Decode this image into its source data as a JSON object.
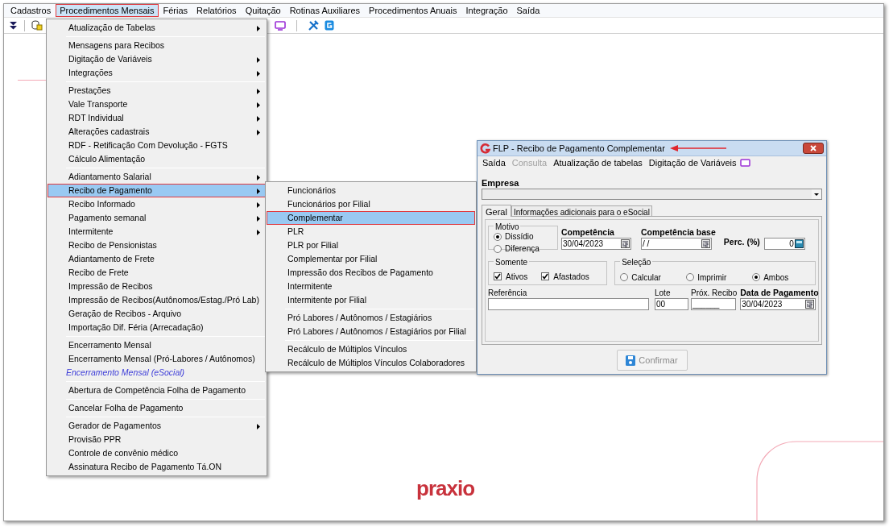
{
  "menubar": [
    {
      "label": "Cadastros",
      "selected": false
    },
    {
      "label": "Procedimentos Mensais",
      "selected": true
    },
    {
      "label": "Férias",
      "selected": false
    },
    {
      "label": "Relatórios",
      "selected": false
    },
    {
      "label": "Quitação",
      "selected": false
    },
    {
      "label": "Rotinas Auxiliares",
      "selected": false
    },
    {
      "label": "Procedimentos Anuais",
      "selected": false
    },
    {
      "label": "Integração",
      "selected": false
    },
    {
      "label": "Saída",
      "selected": false
    }
  ],
  "main_menu": {
    "groups": [
      [
        {
          "label": "Atualização de Tabelas",
          "submenu": true,
          "selected": false,
          "kind": "plain"
        }
      ],
      [
        {
          "label": "Mensagens para Recibos",
          "submenu": false,
          "selected": false,
          "kind": "plain"
        },
        {
          "label": "Digitação de Variáveis",
          "submenu": true,
          "selected": false,
          "kind": "plain"
        },
        {
          "label": "Integrações",
          "submenu": true,
          "selected": false,
          "kind": "plain"
        }
      ],
      [
        {
          "label": "Prestações",
          "submenu": true,
          "selected": false,
          "kind": "plain"
        },
        {
          "label": "Vale Transporte",
          "submenu": true,
          "selected": false,
          "kind": "plain"
        },
        {
          "label": "RDT Individual",
          "submenu": true,
          "selected": false,
          "kind": "plain"
        },
        {
          "label": "Alterações cadastrais",
          "submenu": true,
          "selected": false,
          "kind": "plain"
        },
        {
          "label": "RDF - Retificação Com Devolução - FGTS",
          "submenu": false,
          "selected": false,
          "kind": "plain"
        },
        {
          "label": "Cálculo Alimentação",
          "submenu": false,
          "selected": false,
          "kind": "plain"
        }
      ],
      [
        {
          "label": "Adiantamento Salarial",
          "submenu": true,
          "selected": false,
          "kind": "plain"
        },
        {
          "label": "Recibo de Pagamento",
          "submenu": true,
          "selected": true,
          "kind": "plain"
        },
        {
          "label": "Recibo Informado",
          "submenu": true,
          "selected": false,
          "kind": "plain"
        },
        {
          "label": "Pagamento semanal",
          "submenu": true,
          "selected": false,
          "kind": "plain"
        },
        {
          "label": "Intermitente",
          "submenu": true,
          "selected": false,
          "kind": "plain"
        },
        {
          "label": "Recibo de Pensionistas",
          "submenu": false,
          "selected": false,
          "kind": "plain"
        },
        {
          "label": "Adiantamento de Frete",
          "submenu": false,
          "selected": false,
          "kind": "plain"
        },
        {
          "label": "Recibo de Frete",
          "submenu": false,
          "selected": false,
          "kind": "plain"
        },
        {
          "label": "Impressão de Recibos",
          "submenu": false,
          "selected": false,
          "kind": "plain"
        },
        {
          "label": "Impressão de Recibos(Autônomos/Estag./Pró Lab)",
          "submenu": false,
          "selected": false,
          "kind": "plain"
        },
        {
          "label": "Geração de Recibos - Arquivo",
          "submenu": false,
          "selected": false,
          "kind": "plain"
        },
        {
          "label": "Importação Dif. Féria (Arrecadação)",
          "submenu": false,
          "selected": false,
          "kind": "plain"
        }
      ],
      [
        {
          "label": "Encerramento Mensal",
          "submenu": false,
          "selected": false,
          "kind": "plain"
        },
        {
          "label": "Encerramento Mensal (Pró-Labores / Autônomos)",
          "submenu": false,
          "selected": false,
          "kind": "plain"
        },
        {
          "label": "Encerramento Mensal (eSocial)",
          "submenu": false,
          "selected": false,
          "kind": "emphasized"
        }
      ],
      [
        {
          "label": "Abertura de Competência Folha de Pagamento",
          "submenu": false,
          "selected": false,
          "kind": "plain"
        }
      ],
      [
        {
          "label": "Cancelar Folha de Pagamento",
          "submenu": false,
          "selected": false,
          "kind": "plain"
        }
      ],
      [
        {
          "label": "Gerador de Pagamentos",
          "submenu": true,
          "selected": false,
          "kind": "plain"
        },
        {
          "label": "Provisão PPR",
          "submenu": false,
          "selected": false,
          "kind": "plain"
        },
        {
          "label": "Controle de convênio médico",
          "submenu": false,
          "selected": false,
          "kind": "plain"
        },
        {
          "label": "Assinatura Recibo de Pagamento Tá.ON",
          "submenu": false,
          "selected": false,
          "kind": "plain"
        }
      ]
    ]
  },
  "submenu": {
    "groups": [
      [
        {
          "label": "Funcionários",
          "selected": false
        },
        {
          "label": "Funcionários por Filial",
          "selected": false
        },
        {
          "label": "Complementar",
          "selected": true
        },
        {
          "label": "PLR",
          "selected": false
        },
        {
          "label": "PLR por Filial",
          "selected": false
        },
        {
          "label": "Complementar por Filial",
          "selected": false
        },
        {
          "label": "Impressão dos Recibos de Pagamento",
          "selected": false
        },
        {
          "label": "Intermitente",
          "selected": false
        },
        {
          "label": "Intermitente por Filial",
          "selected": false
        }
      ],
      [
        {
          "label": "Pró Labores / Autônomos / Estagiários",
          "selected": false
        },
        {
          "label": "Pró Labores / Autônomos / Estagiários por Filial",
          "selected": false
        }
      ],
      [
        {
          "label": "Recálculo de Múltiplos Vínculos",
          "selected": false
        },
        {
          "label": "Recálculo de Múltiplos Vínculos Colaboradores",
          "selected": false
        }
      ]
    ]
  },
  "dialog": {
    "title": "FLP - Recibo de Pagamento Complementar",
    "menu": [
      {
        "label": "Saída",
        "disabled": false
      },
      {
        "label": "Consulta",
        "disabled": true
      },
      {
        "label": "Atualização de tabelas",
        "disabled": false
      },
      {
        "label": "Digitação de Variáveis",
        "disabled": false
      }
    ],
    "empresa": {
      "label": "Empresa"
    },
    "tabs": [
      {
        "label": "Geral",
        "selected": true
      },
      {
        "label": "Informações adicionais para o eSocial",
        "selected": false
      }
    ],
    "motivo": {
      "label": "Motivo",
      "options": [
        {
          "label": "Dissídio",
          "selected": true
        },
        {
          "label": "Diferença",
          "selected": false
        }
      ]
    },
    "competencia": {
      "label": "Competência",
      "value": "30/04/2023"
    },
    "competencia_base": {
      "label": "Competência base",
      "value": "/ /"
    },
    "perc": {
      "label": "Perc. (%)",
      "value": "0"
    },
    "somente": {
      "label": "Somente",
      "options": [
        {
          "label": "Ativos",
          "checked": true
        },
        {
          "label": "Afastados",
          "checked": true
        }
      ]
    },
    "selecao": {
      "label": "Seleção",
      "options": [
        {
          "label": "Calcular",
          "selected": false
        },
        {
          "label": "Imprimir",
          "selected": false
        },
        {
          "label": "Ambos",
          "selected": true
        }
      ]
    },
    "referencia": {
      "label": "Referência"
    },
    "lote": {
      "label": "Lote",
      "value": "00"
    },
    "prox_recibo": {
      "label": "Próx. Recibo",
      "value": "______"
    },
    "data_pagamento": {
      "label": "Data de Pagamento",
      "value": "30/04/2023"
    },
    "confirm_button": {
      "label": "Confirmar",
      "disabled": true
    }
  },
  "logo": "praxio"
}
